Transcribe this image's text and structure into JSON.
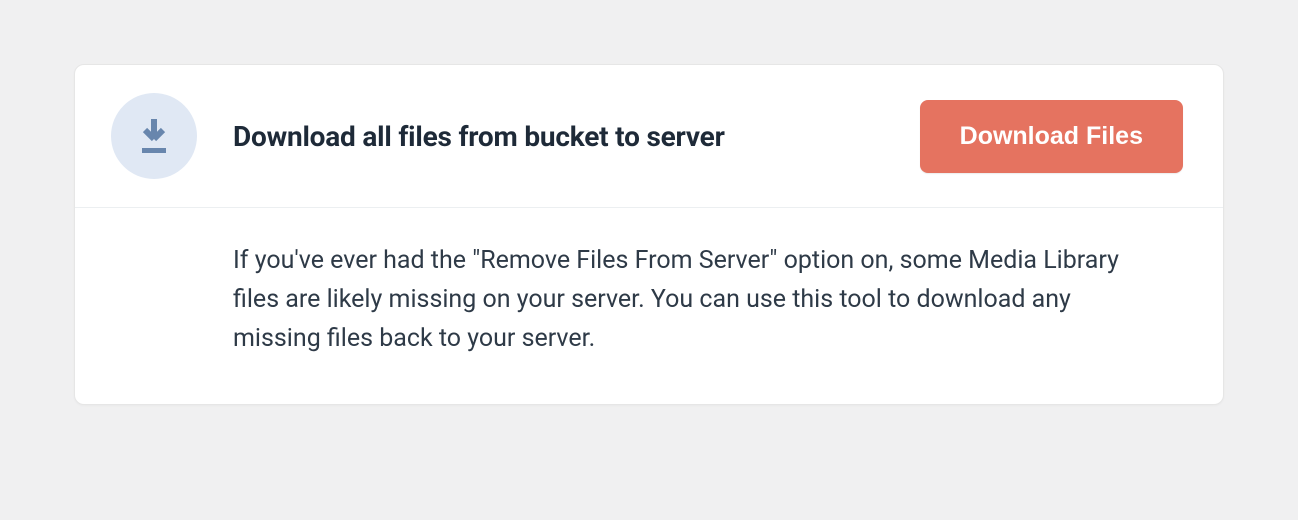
{
  "tool": {
    "icon": "download-icon",
    "title": "Download all files from bucket to server",
    "button_label": "Download Files",
    "description": "If you've ever had the \"Remove Files From Server\" option on, some Media Library files are likely missing on your server. You can use this tool to download any missing files back to your server."
  },
  "colors": {
    "accent": "#e57360",
    "icon_bg": "#e0e8f4",
    "icon_fg": "#6886ad"
  }
}
